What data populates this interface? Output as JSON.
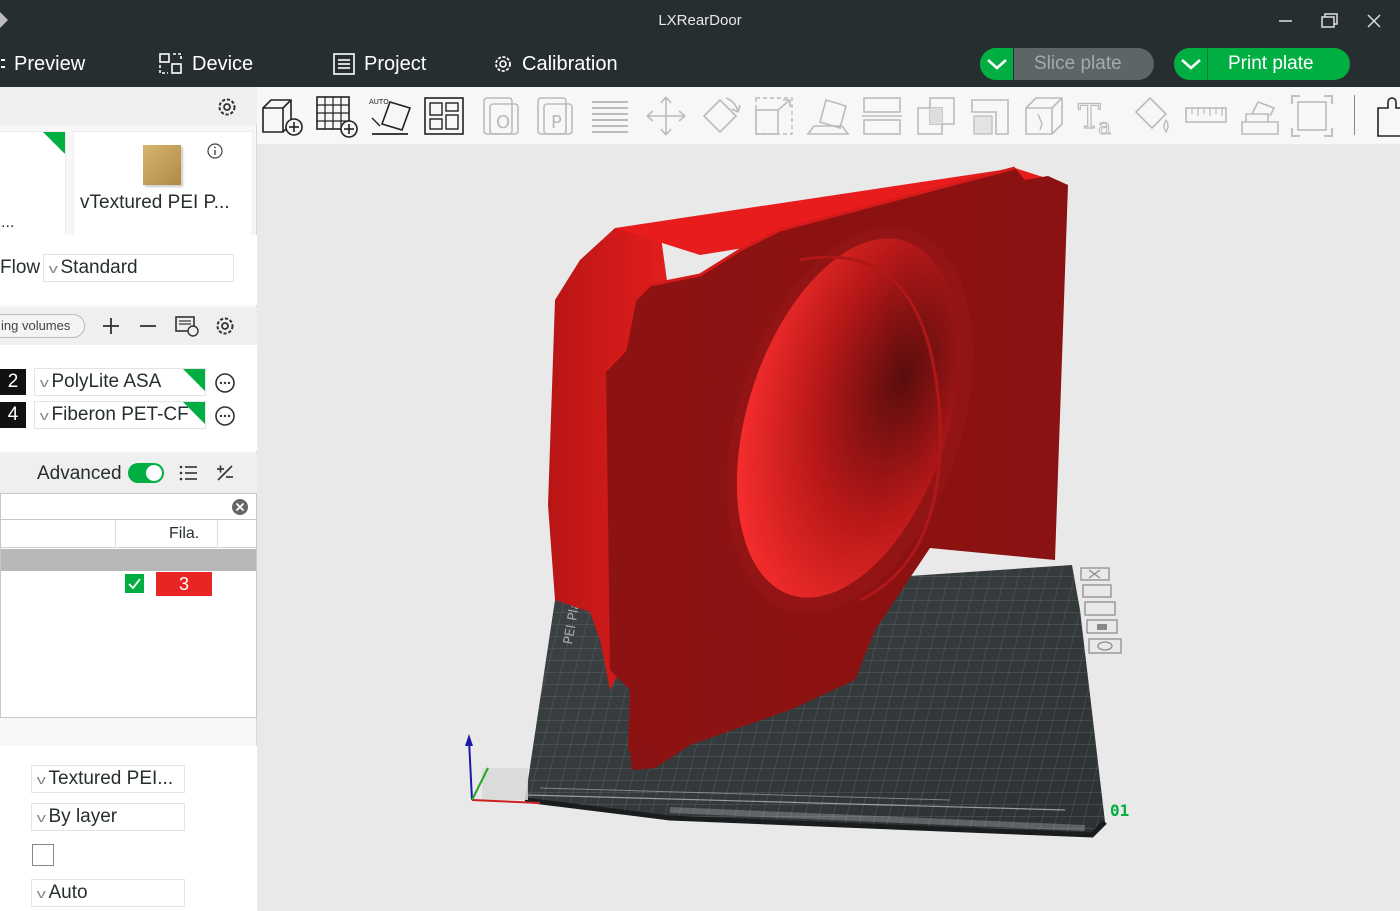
{
  "window": {
    "title": "LXRearDoor"
  },
  "nav": {
    "preview": "Preview",
    "device": "Device",
    "project": "Project",
    "calibration": "Calibration",
    "slice_plate": "Slice plate",
    "print_plate": "Print plate"
  },
  "sidebar": {
    "printer_ellipsis": "...",
    "plate_type": "Textured PEI P...",
    "flow_label": "Flow",
    "flow_value": "Standard",
    "volumes_label": "ing volumes",
    "filaments": [
      {
        "index": "2",
        "name": "PolyLite ASA"
      },
      {
        "index": "4",
        "name": "Fiberon PET-CF"
      }
    ],
    "advanced_label": "Advanced",
    "table": {
      "header": "Fila.",
      "row_value": "3"
    },
    "bottom": {
      "plate": "Textured PEI...",
      "sequence": "By layer",
      "auto": "Auto"
    }
  },
  "viewport": {
    "plate_number": "01",
    "plate_label": "PEI Plate"
  },
  "colors": {
    "accent": "#00ae42",
    "dark": "#262e30",
    "model": "#c81818",
    "badge_red": "#e82525"
  }
}
